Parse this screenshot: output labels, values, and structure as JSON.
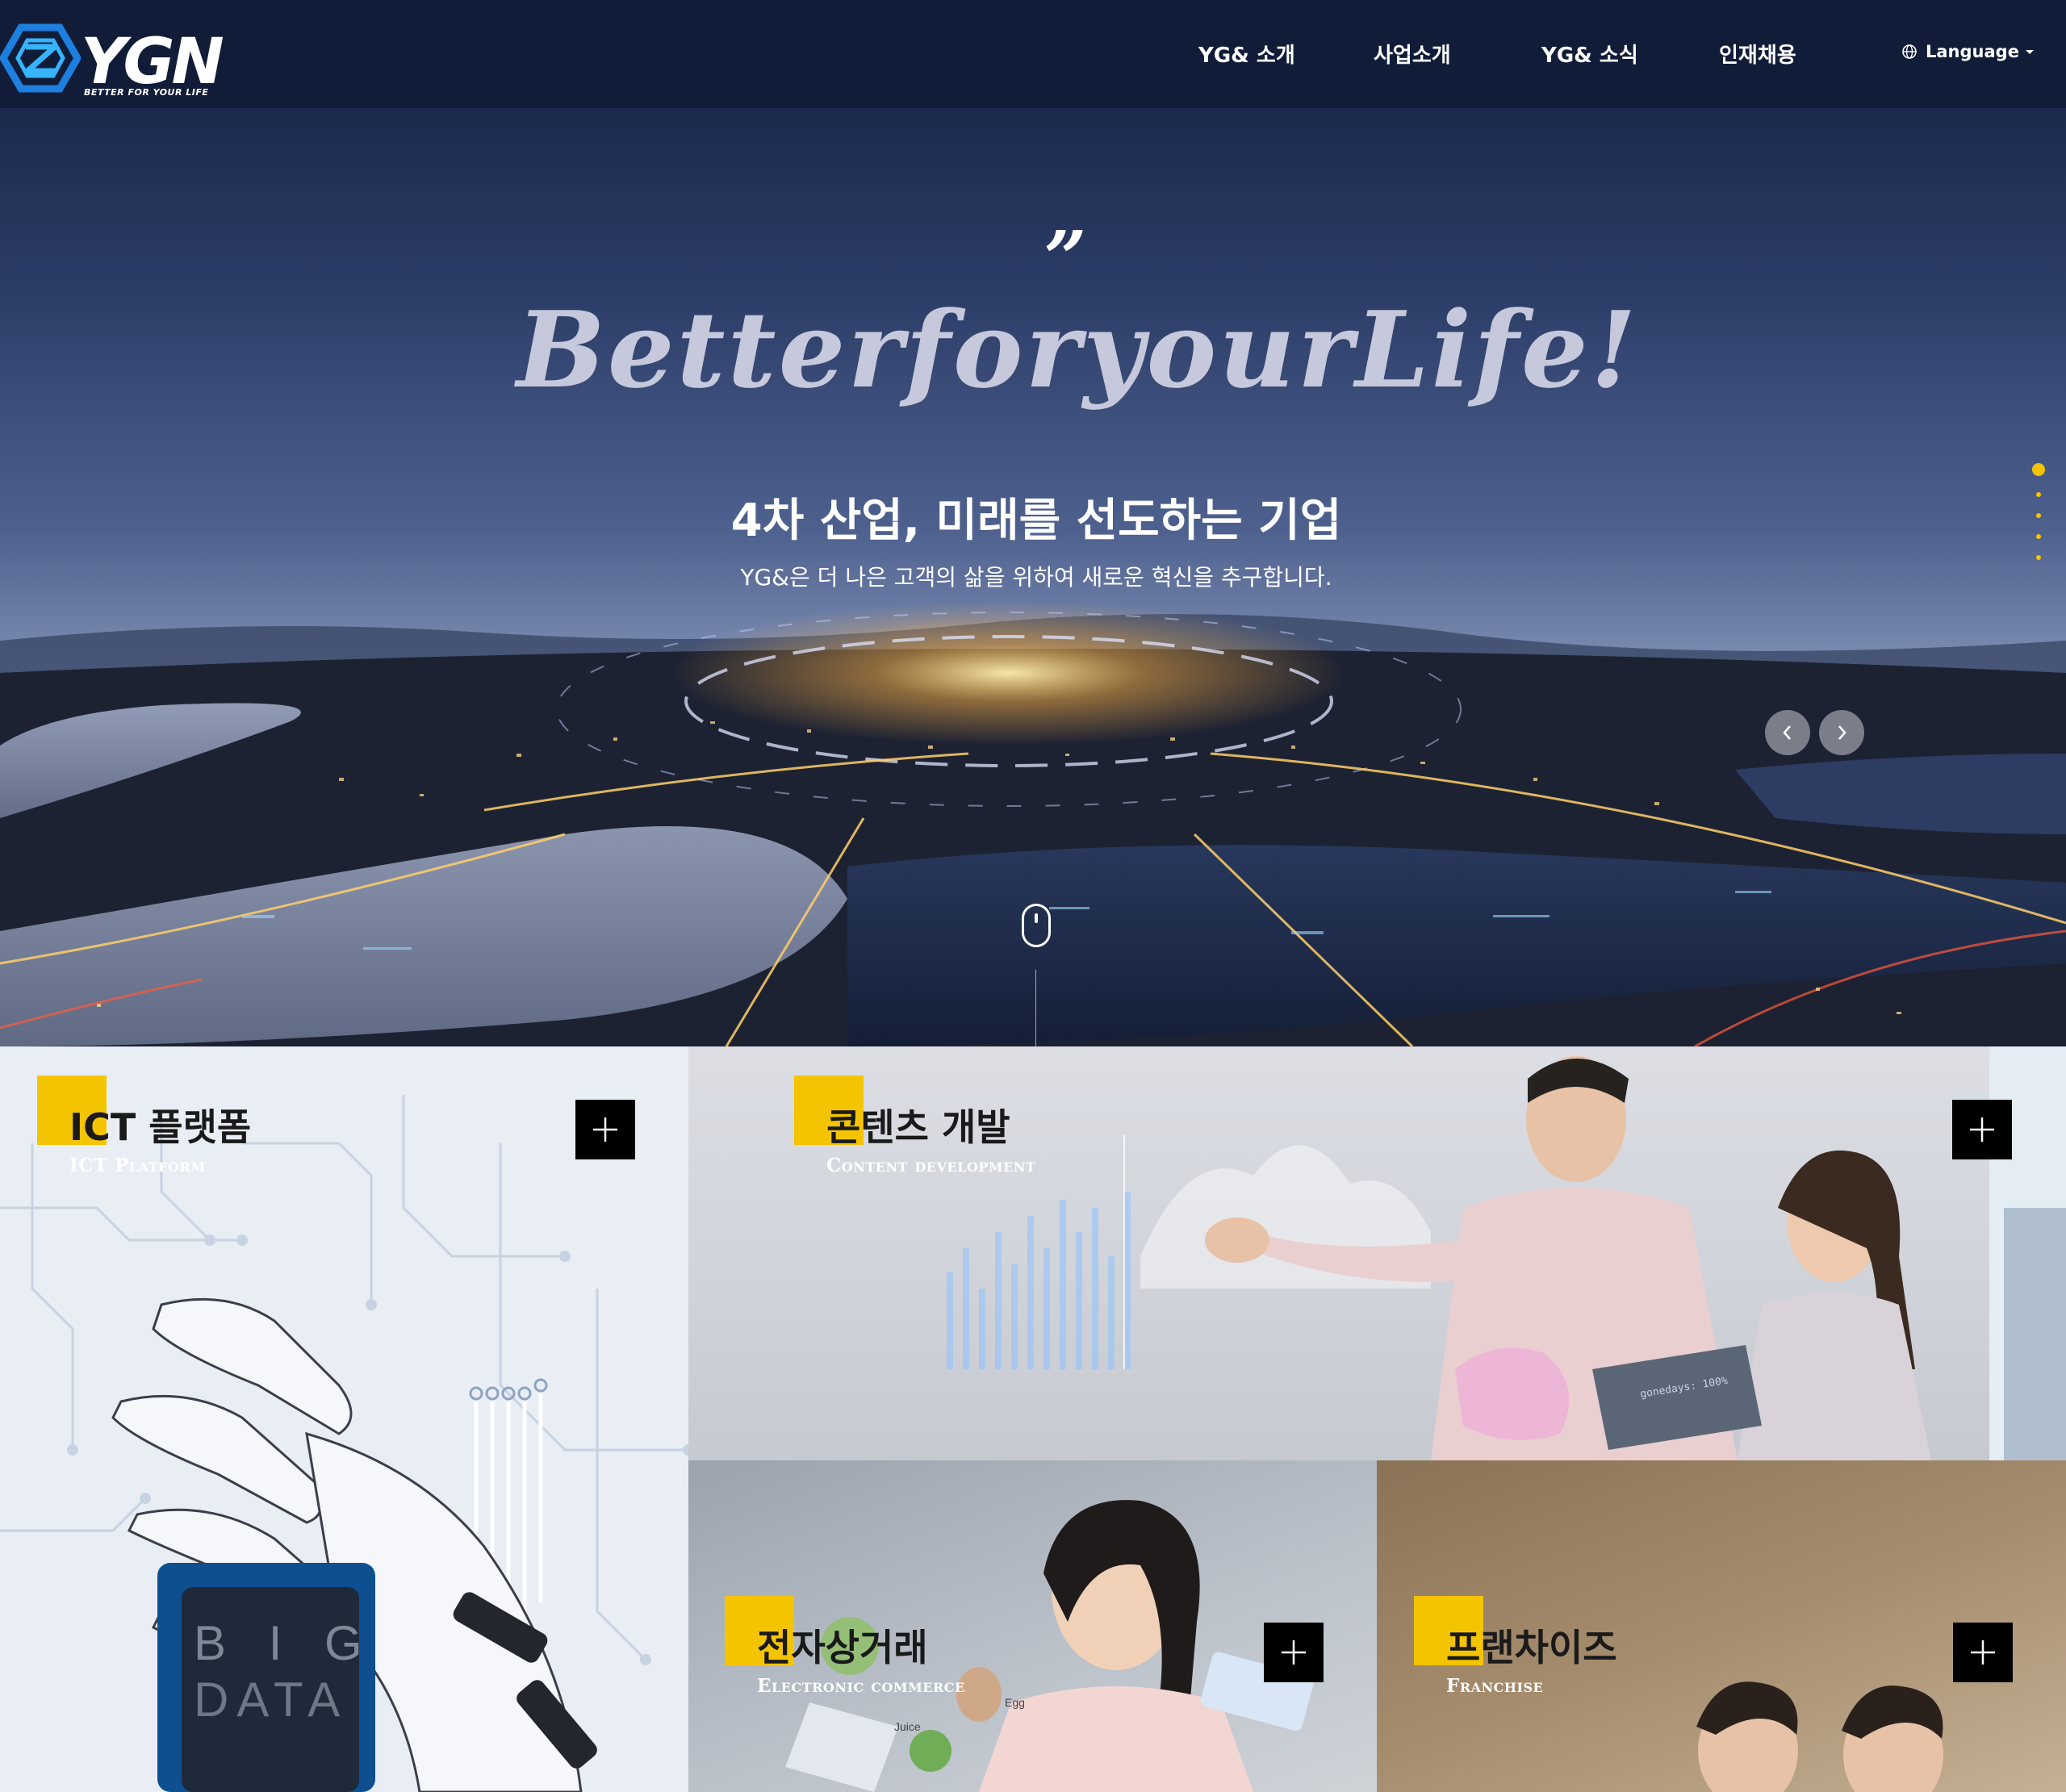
{
  "header": {
    "logo_text": "YGN",
    "logo_tagline": "BETTER FOR YOUR LIFE",
    "nav": [
      "YG& 소개",
      "사업소개",
      "YG& 소식",
      "인재채용"
    ],
    "language_label": "Language"
  },
  "hero": {
    "quote_mark": "”",
    "slogan": "BetterforyourLife!",
    "title": "4차 산업, 미래를 선도하는 기업",
    "subtitle": "YG&은 더 나은 고객의 삶을 위하여 새로운 혁신을 추구합니다.",
    "slide_count": 5,
    "active_slide": 1,
    "accent_color": "#f5c400"
  },
  "tiles": [
    {
      "title": "ICT 플랫폼",
      "subtitle": "ICT Platform",
      "image_text": "B I G DATA"
    },
    {
      "title": "콘텐츠 개발",
      "subtitle": "Content development"
    },
    {
      "title": "전자상거래",
      "subtitle": "Electronic commerce",
      "image_labels": [
        "Egg",
        "Juice"
      ]
    },
    {
      "title": "프랜차이즈",
      "subtitle": "Franchise"
    }
  ],
  "colors": {
    "header_bg": "#111d38",
    "accent_yellow": "#f5c400",
    "plus_button_bg": "#000000"
  },
  "icons": {
    "logo": "ygn-hexagon-logo",
    "language": "globe-icon",
    "prev": "chevron-left-icon",
    "next": "chevron-right-icon",
    "scroll": "mouse-scroll-icon",
    "tile_action": "plus-icon"
  }
}
